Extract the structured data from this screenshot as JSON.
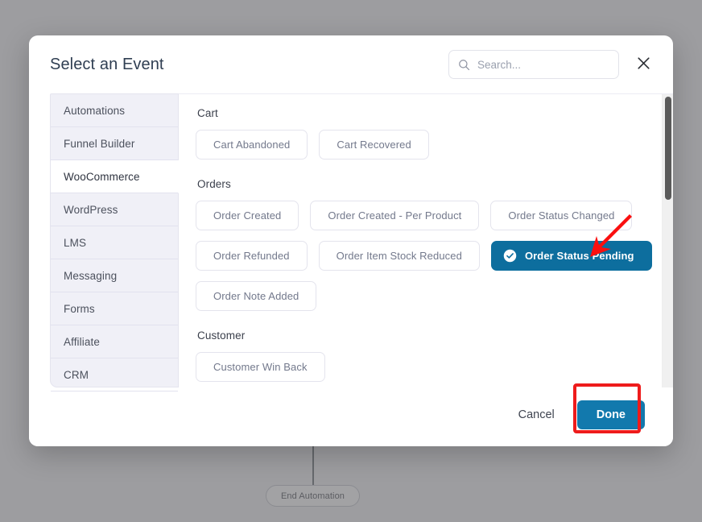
{
  "background": {
    "end_node_label": "End Automation"
  },
  "modal": {
    "title": "Select an Event",
    "search": {
      "placeholder": "Search...",
      "value": "",
      "icon": "search-icon"
    },
    "close_icon": "close-icon",
    "sidebar": {
      "items": [
        {
          "label": "Automations",
          "active": false
        },
        {
          "label": "Funnel Builder",
          "active": false
        },
        {
          "label": "WooCommerce",
          "active": true
        },
        {
          "label": "WordPress",
          "active": false
        },
        {
          "label": "LMS",
          "active": false
        },
        {
          "label": "Messaging",
          "active": false
        },
        {
          "label": "Forms",
          "active": false
        },
        {
          "label": "Affiliate",
          "active": false
        },
        {
          "label": "CRM",
          "active": false
        }
      ]
    },
    "groups": [
      {
        "title": "Cart",
        "chips": [
          {
            "label": "Cart Abandoned",
            "selected": false
          },
          {
            "label": "Cart Recovered",
            "selected": false
          }
        ]
      },
      {
        "title": "Orders",
        "chips": [
          {
            "label": "Order Created",
            "selected": false
          },
          {
            "label": "Order Created - Per Product",
            "selected": false
          },
          {
            "label": "Order Status Changed",
            "selected": false
          },
          {
            "label": "Order Refunded",
            "selected": false
          },
          {
            "label": "Order Item Stock Reduced",
            "selected": false
          },
          {
            "label": "Order Status Pending",
            "selected": true,
            "icon": "check-circle-icon"
          },
          {
            "label": "Order Note Added",
            "selected": false
          }
        ]
      },
      {
        "title": "Customer",
        "chips": [
          {
            "label": "Customer Win Back",
            "selected": false
          }
        ]
      }
    ],
    "footer": {
      "cancel_label": "Cancel",
      "done_label": "Done"
    }
  },
  "colors": {
    "accent_blue": "#1279ad",
    "selected_chip_blue": "#0d6e9e",
    "annotation_red": "#ee1b1b",
    "sidebar_bg": "#f0f0f7"
  }
}
